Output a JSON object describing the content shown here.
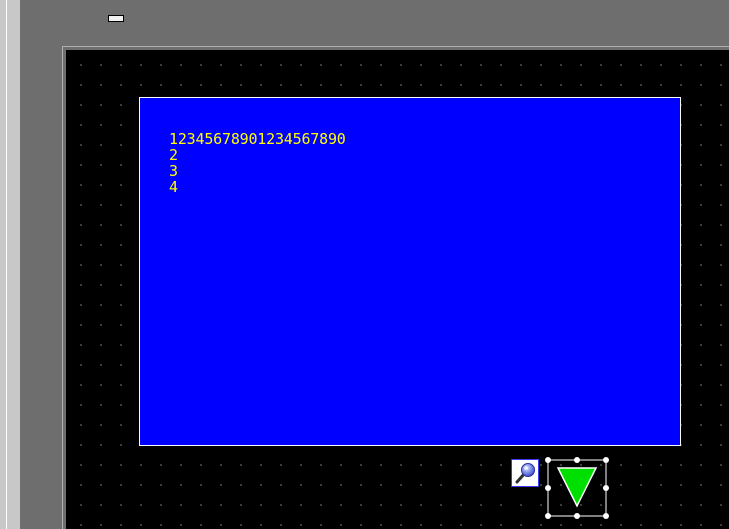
{
  "window": {
    "minimize_icon": "minimize-icon"
  },
  "screen": {
    "background_color": "#000000",
    "grid": true
  },
  "text_window": {
    "background_color": "#0000ff",
    "text_color": "#ffff00",
    "lines": [
      "12345678901234567890",
      "2",
      "3",
      "4"
    ]
  },
  "parts": {
    "zoom_icon": "magnifier-icon",
    "scroll_icon": "triangle-down-icon",
    "scroll_color": "#00e000",
    "selected": "triangle-down-icon"
  }
}
